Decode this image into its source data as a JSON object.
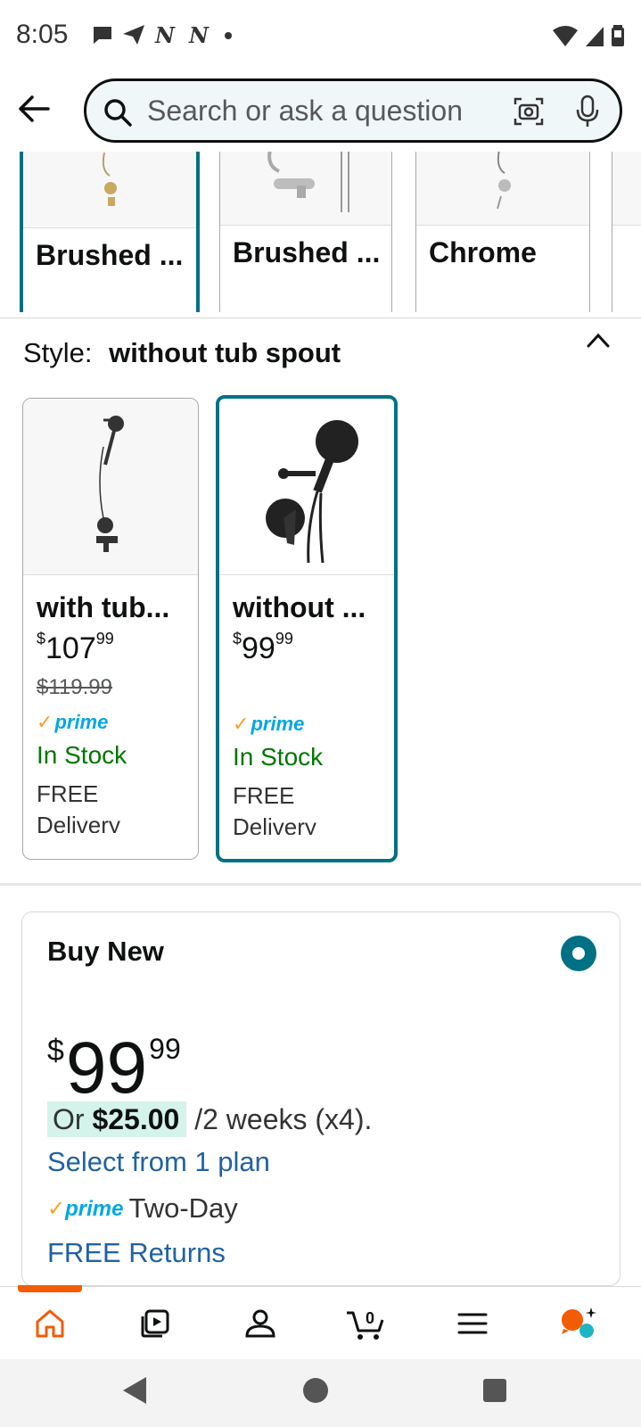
{
  "status_bar": {
    "time": "8:05",
    "notification_icons": [
      "chat-icon",
      "send-icon",
      "nyt-icon",
      "nyt-icon",
      "dot-icon"
    ],
    "system_icons": [
      "wifi-icon",
      "signal-icon",
      "battery-icon"
    ]
  },
  "header": {
    "search_placeholder": "Search or ask a question"
  },
  "color_options": [
    {
      "label": "Brushed ...",
      "selected": true
    },
    {
      "label": "Brushed ...",
      "selected": false
    },
    {
      "label": "Chrome",
      "selected": false
    }
  ],
  "style": {
    "label": "Style:",
    "value": "without tub spout",
    "options": [
      {
        "title": "with tub...",
        "price_whole": "107",
        "price_cents": "99",
        "currency": "$",
        "list_price": "$119.99",
        "prime": "prime",
        "stock": "In Stock",
        "free": "FREE",
        "delivery": "Delivery",
        "selected": false
      },
      {
        "title": "without ...",
        "price_whole": "99",
        "price_cents": "99",
        "currency": "$",
        "list_price": "",
        "prime": "prime",
        "stock": "In Stock",
        "free": "FREE",
        "delivery": "Delivery",
        "selected": true
      }
    ]
  },
  "buy_box": {
    "title": "Buy New",
    "currency": "$",
    "price_whole": "99",
    "price_cents": "99",
    "installment_prefix": "Or",
    "installment_amount": "$25.00",
    "installment_suffix": "/2 weeks (x4).",
    "select_plan": "Select from 1 plan",
    "prime": "prime",
    "shipping": "Two-Day",
    "returns": "FREE Returns",
    "selected": true
  },
  "bottom_nav": {
    "items": [
      "home-icon",
      "video-icon",
      "account-icon",
      "cart-icon",
      "menu-icon",
      "rufus-icon"
    ],
    "cart_count": "0",
    "active": "home-icon"
  },
  "colors": {
    "accent": "#007185",
    "link": "#2162a1",
    "stock": "#007600",
    "prime": "#00a8e1",
    "nav_active": "#f25c05"
  }
}
